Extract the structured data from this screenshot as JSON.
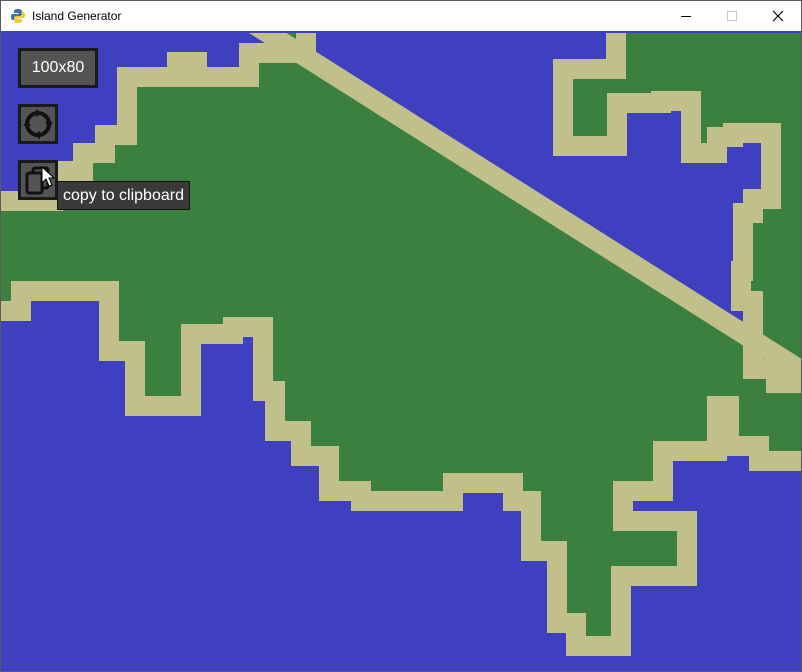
{
  "window": {
    "title": "Island Generator"
  },
  "controls": {
    "size_label": "100x80",
    "regenerate_icon": "refresh-icon",
    "copy_icon": "copy-icon"
  },
  "tooltip": {
    "text": "copy to clipboard"
  },
  "colors": {
    "water": "#3e40bf",
    "sand": "#c1c08a",
    "land": "#3c8040",
    "button": "#545454",
    "button_border": "#1a1a1a",
    "tooltip_bg": "#3a3a3a"
  }
}
